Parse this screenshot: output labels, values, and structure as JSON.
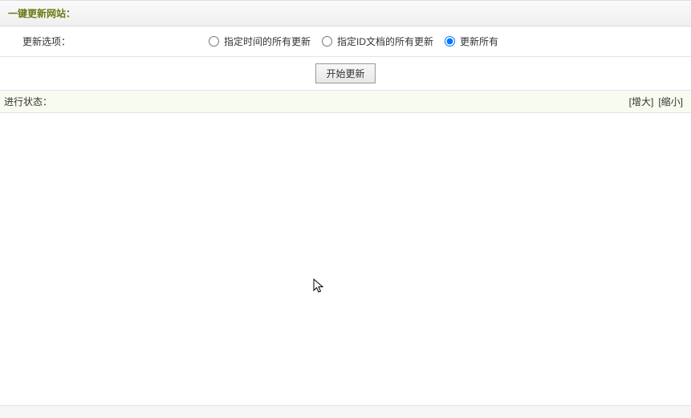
{
  "header": {
    "title": "一键更新网站："
  },
  "options": {
    "label": "更新选项：",
    "radios": [
      {
        "label": "指定时间的所有更新",
        "checked": false
      },
      {
        "label": "指定ID文档的所有更新",
        "checked": false
      },
      {
        "label": "更新所有",
        "checked": true
      }
    ]
  },
  "actions": {
    "start_label": "开始更新"
  },
  "status": {
    "label": "进行状态：",
    "expand": "[增大]",
    "shrink": "[缩小]"
  }
}
